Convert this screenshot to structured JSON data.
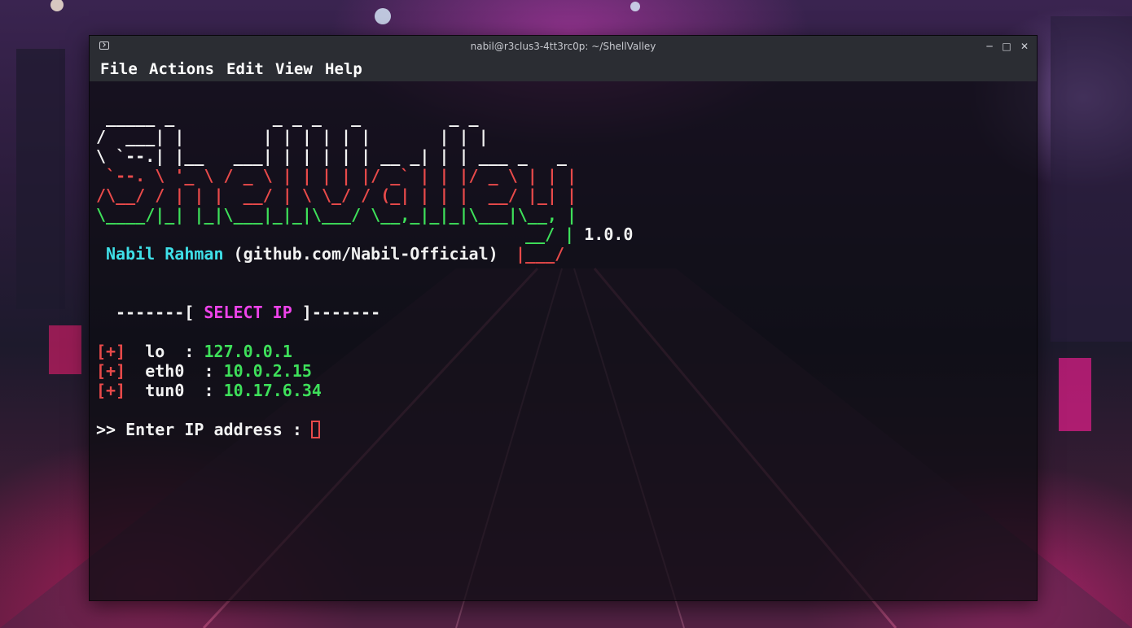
{
  "window": {
    "title": "nabil@r3clus3-4tt3rc0p: ~/ShellValley",
    "controls": {
      "minimize": "─",
      "maximize": "□",
      "close": "✕"
    }
  },
  "menu": {
    "file": "File",
    "actions": "Actions",
    "edit": "Edit",
    "view": "View",
    "help": "Help"
  },
  "banner": {
    "l1": " _____ _          _ _ _   _         _ _",
    "l2": "/  ___| |        | | | | | |       | | |",
    "l3": "\\ `--.| |__   ___| | | | | | __ _| | | ___ _   _",
    "l4": " `--. \\ '_ \\ / _ \\ | | | | |/ _` | | |/ _ \\ | | |",
    "l5": "/\\__/ / | | |  __/ | \\ \\_/ / (_| | | |  __/ |_| |",
    "l6": "\\____/|_| |_|\\___|_|_|\\___/ \\__,_|_|_|\\___|\\__, |",
    "l7": "__/ |",
    "version": "1.0.0",
    "author": "Nabil Rahman",
    "github": "(github.com/Nabil-Official)",
    "l8": "|___/"
  },
  "select": {
    "left": "-------[ ",
    "label": "SELECT IP",
    "right": " ]-------"
  },
  "interfaces": [
    {
      "marker": "[+]",
      "name": "lo  ",
      "sep": ": ",
      "ip": "127.0.0.1"
    },
    {
      "marker": "[+]",
      "name": "eth0 ",
      "sep": " : ",
      "ip": "10.0.2.15"
    },
    {
      "marker": "[+]",
      "name": "tun0 ",
      "sep": " : ",
      "ip": "10.17.6.34"
    }
  ],
  "prompt": {
    "text": ">> Enter IP address : "
  },
  "colors": {
    "red": "#e84a4a",
    "green": "#3ee05a",
    "cyan": "#3fe0e8",
    "magenta": "#ee43ea",
    "titlebar": "#2b2d33"
  }
}
